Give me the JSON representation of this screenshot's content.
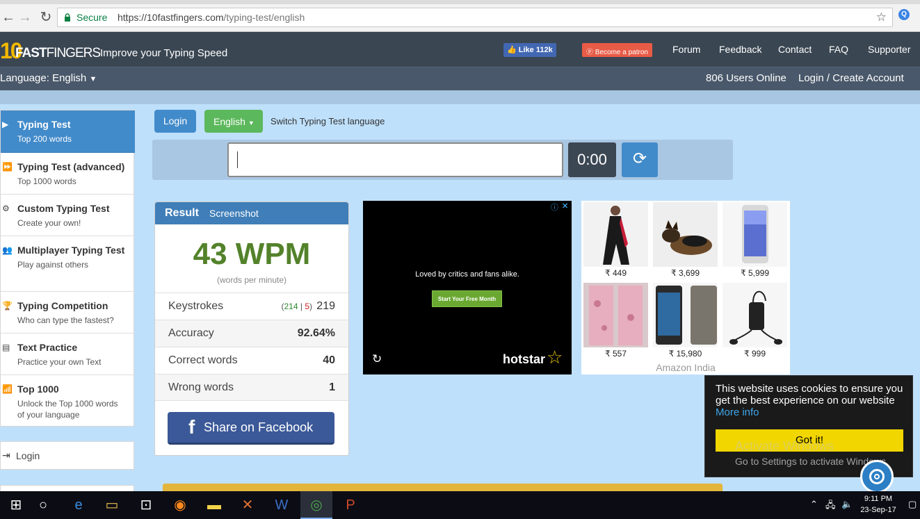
{
  "browser": {
    "secure_label": "Secure",
    "url_domain": "https://10fastfingers.com",
    "url_path": "/typing-test/english"
  },
  "site": {
    "logo_ten": "10",
    "logo_fast": "FAST",
    "logo_fingers": "FINGERS",
    "tagline": "Improve your Typing Speed",
    "fb_like": "Like 112k",
    "patron": "Become a patron",
    "nav": [
      "Forum",
      "Feedback",
      "Contact",
      "FAQ",
      "Supporter"
    ],
    "language": "Language: English",
    "users_online": "806 Users Online",
    "login_create": "Login / Create Account"
  },
  "sidebar": {
    "items": [
      {
        "title": "Typing Test",
        "sub": "Top 200 words"
      },
      {
        "title": "Typing Test (advanced)",
        "sub": "Top 1000 words"
      },
      {
        "title": "Custom Typing Test",
        "sub": "Create your own!"
      },
      {
        "title": "Multiplayer Typing Test",
        "sub": "Play against others"
      },
      {
        "title": "Typing Competition",
        "sub": "Who can type the fastest?"
      },
      {
        "title": "Text Practice",
        "sub": "Practice your own Text"
      },
      {
        "title": "Top 1000",
        "sub": "Unlock the Top 1000 words of your language"
      }
    ],
    "login": "Login"
  },
  "main": {
    "login_btn": "Login",
    "lang_btn": "English",
    "switch_text": "Switch Typing Test language",
    "timer": "0:00"
  },
  "result": {
    "title": "Result",
    "screenshot": "Screenshot",
    "wpm": "43 WPM",
    "wpm_sub": "(words per minute)",
    "keystrokes_label": "Keystrokes",
    "keystrokes_open": "(",
    "keystrokes_correct": "214",
    "keystrokes_sep": "|",
    "keystrokes_wrong": "5",
    "keystrokes_close": ")",
    "keystrokes_total": "219",
    "accuracy_label": "Accuracy",
    "accuracy": "92.64%",
    "correct_label": "Correct words",
    "correct": "40",
    "wrong_label": "Wrong words",
    "wrong": "1",
    "share": "Share on Facebook"
  },
  "ad_hotstar": {
    "tagline": "Loved by critics and fans alike.",
    "cta": "Start Your Free Month",
    "brand": "hotstar"
  },
  "ad_amazon": {
    "prices": [
      "₹ 449",
      "₹ 3,699",
      "₹ 5,999",
      "₹ 557",
      "₹ 15,980",
      "₹ 999"
    ],
    "footer": "Amazon India"
  },
  "cookie": {
    "message": "This website uses cookies to ensure you get the best experience on our website",
    "more": "More info",
    "button": "Got it!",
    "watermark1": "Activate Windows",
    "watermark2": "Go to Settings to activate Windows."
  },
  "taskbar": {
    "time": "9:11 PM",
    "date": "23-Sep-17"
  },
  "colors": {
    "accent_blue": "#428bca",
    "green": "#5cb85c",
    "wpm_green": "#53822a",
    "cookie_yellow": "#f1d600"
  }
}
